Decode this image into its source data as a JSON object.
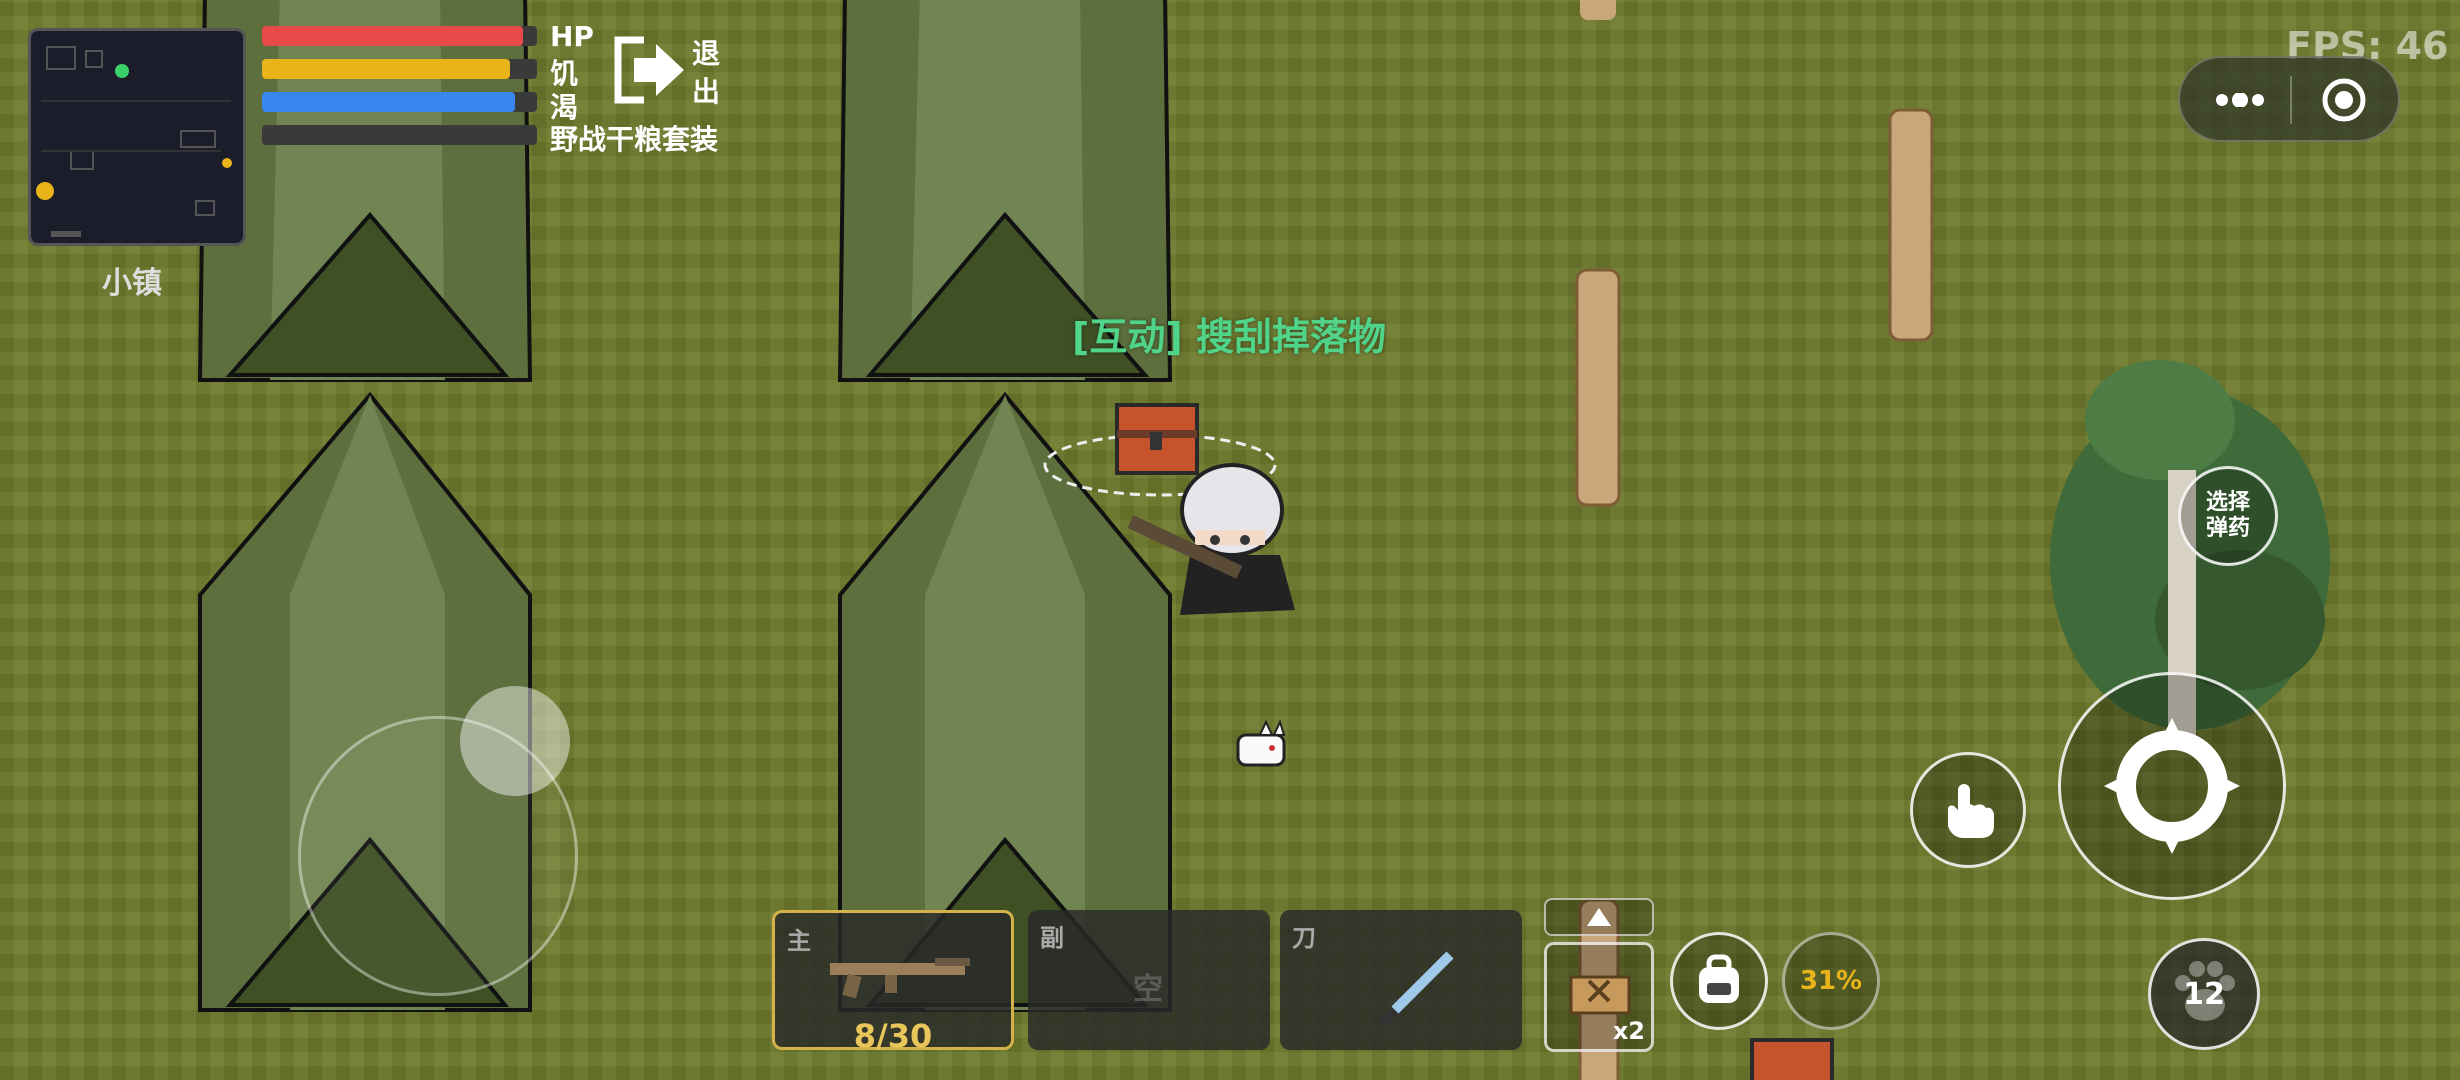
{
  "hud": {
    "stat_labels": [
      "HP",
      "饥",
      "渴"
    ],
    "item_label": "野战干粮套装",
    "exit_label_1": "退",
    "exit_label_2": "出",
    "fps": "FPS: 46",
    "hp": 0.95,
    "hunger": 0.9,
    "thirst": 0.92,
    "bar_colors": {
      "hp": "#e84a4a",
      "hunger": "#e9b41a",
      "thirst": "#3a86f0"
    }
  },
  "minimap": {
    "location": "小镇"
  },
  "prompt": {
    "text": "[互动] 搜刮掉落物",
    "color": "#4fd48a"
  },
  "weapons": [
    {
      "tag": "主",
      "ammo": "8/30",
      "icon": "rifle-icon"
    },
    {
      "tag": "副",
      "empty": "空",
      "icon": ""
    },
    {
      "tag": "刀",
      "icon": "knife-icon"
    }
  ],
  "quick": {
    "count": "x2",
    "percent": "31%"
  },
  "buttons": {
    "select_ammo_line1": "选择",
    "select_ammo_line2": "弹药",
    "pet_count": "12"
  }
}
